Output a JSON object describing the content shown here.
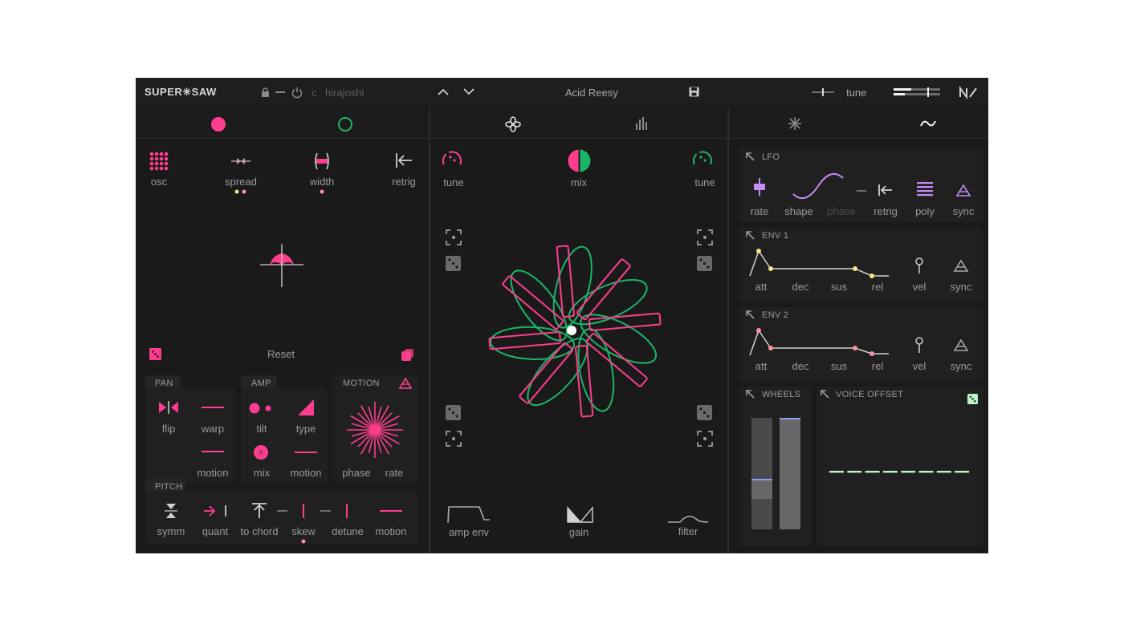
{
  "header": {
    "logo": "SUPER✳SAW",
    "scale_prefix": "c",
    "scale_name": "hirajoshi",
    "preset_name": "Acid Reesy",
    "tune_label": "tune"
  },
  "left": {
    "osc_label": "osc",
    "spread_label": "spread",
    "width_label": "width",
    "retrig_label": "retrig",
    "reset_label": "Reset",
    "pan": {
      "title": "PAN",
      "flip": "flip",
      "warp": "warp",
      "motion": "motion"
    },
    "amp": {
      "title": "AMP",
      "tilt": "tilt",
      "type": "type",
      "mix": "mix",
      "motion": "motion"
    },
    "motion": {
      "title": "MOTION",
      "phase": "phase",
      "rate": "rate"
    },
    "pitch": {
      "title": "PITCH",
      "symm": "symm",
      "quant": "quant",
      "to_chord": "to chord",
      "skew": "skew",
      "detune": "detune",
      "motion": "motion"
    }
  },
  "middle": {
    "tune_left": "tune",
    "mix": "mix",
    "tune_right": "tune",
    "amp_env": "amp env",
    "gain": "gain",
    "filter": "filter"
  },
  "right": {
    "lfo": {
      "title": "LFO",
      "rate": "rate",
      "shape": "shape",
      "phase": "phase",
      "retrig": "retrig",
      "poly": "poly",
      "sync": "sync"
    },
    "env1": {
      "title": "ENV 1",
      "att": "att",
      "dec": "dec",
      "sus": "sus",
      "rel": "rel",
      "vel": "vel",
      "sync": "sync"
    },
    "env2": {
      "title": "ENV 2",
      "att": "att",
      "dec": "dec",
      "sus": "sus",
      "rel": "rel",
      "vel": "vel",
      "sync": "sync"
    },
    "wheels": {
      "title": "WHEELS",
      "wheel1_level": 0.28,
      "wheel2_level": 1.0
    },
    "voice_offset": {
      "title": "VOICE OFFSET",
      "offset_count": 8,
      "offset_level": 0.5
    }
  },
  "colors": {
    "pink": "#ff3d8f",
    "green": "#1ab567",
    "purple": "#c58cf5",
    "yellow": "#f5e77e",
    "salmon": "#ff8fa3",
    "mint": "#b8f5c8",
    "bg": "#1a1a1a"
  }
}
